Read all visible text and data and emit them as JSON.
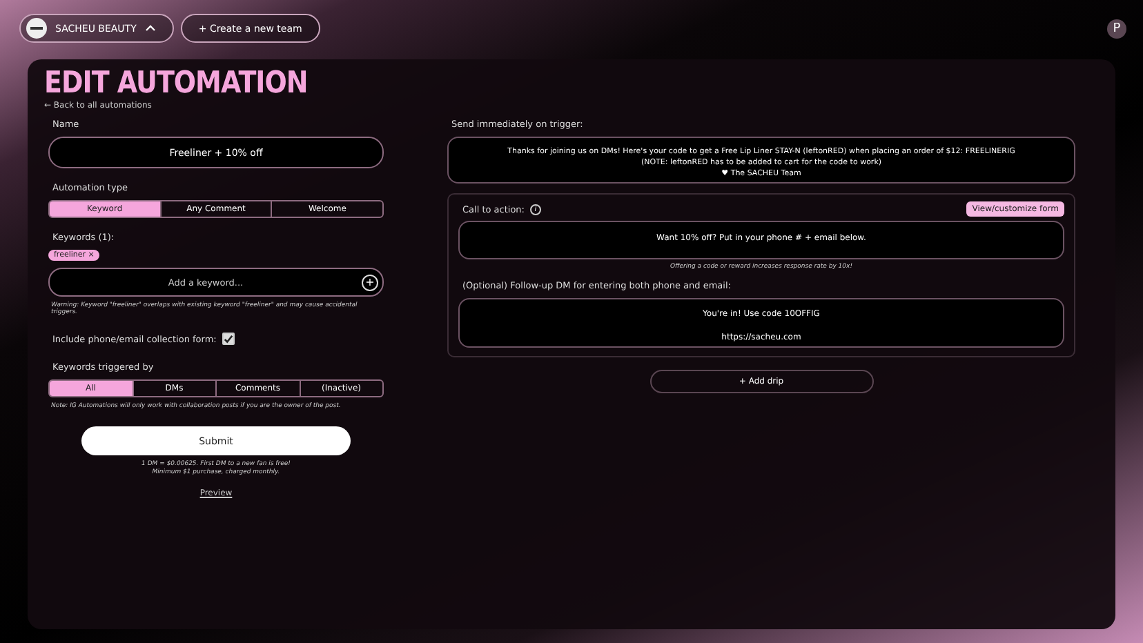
{
  "header": {
    "team": "SACHEU BEAUTY",
    "create_team": "+ Create a new team",
    "user_initial": "P"
  },
  "title": "EDIT AUTOMATION",
  "back_link": "← Back to all automations",
  "name_field": {
    "label": "Name",
    "value": "Freeliner + 10% off"
  },
  "automation_type": {
    "label": "Automation type",
    "options": [
      {
        "label": "Keyword",
        "selected": true
      },
      {
        "label": "Any Comment",
        "selected": false
      },
      {
        "label": "Welcome",
        "selected": false
      }
    ]
  },
  "keywords": {
    "label": "Keywords (1):",
    "tags": [
      "freeliner ×"
    ],
    "placeholder": "Add a keyword...",
    "add": "+",
    "warning": "Warning: Keyword \"freeliner\" overlaps with existing keyword \"freeliner\" and may cause accidental triggers."
  },
  "collection_form": {
    "label": "Include phone/email collection form:",
    "checked": true
  },
  "triggered_by": {
    "label": "Keywords triggered by",
    "options": [
      {
        "label": "All",
        "selected": true
      },
      {
        "label": "DMs",
        "selected": false
      },
      {
        "label": "Comments",
        "selected": false
      },
      {
        "label": "(Inactive)",
        "selected": false
      }
    ],
    "note": "Note: IG Automations will only work with collaboration posts if you are the owner of the post."
  },
  "submit": "Submit",
  "pricing": [
    "1 DM = $0.00625. First DM to a new fan is free!",
    "Minimum $1 purchase, charged monthly."
  ],
  "preview": "Preview",
  "send_label": "Send immediately on trigger:",
  "send_message": [
    "Thanks for joining us on DMs! Here's your code to get a Free Lip Liner STAY-N (leftonRED) when placing an order of $12: FREELINERIG",
    "(NOTE: leftonRED has to be added to cart for the code to work)",
    "♥ The SACHEU Team"
  ],
  "cta": {
    "label": "Call to action:",
    "info": "i",
    "button": "View/customize form",
    "message": "Want 10% off? Put in your phone # + email below.",
    "hint": "Offering a code or reward increases response rate by 10x!"
  },
  "followup": {
    "label": "(Optional) Follow-up DM for entering both phone and email:",
    "message": [
      "You're in! Use code 10OFFIG",
      "https://sacheu.com"
    ]
  },
  "add_drip": "+ Add drip"
}
